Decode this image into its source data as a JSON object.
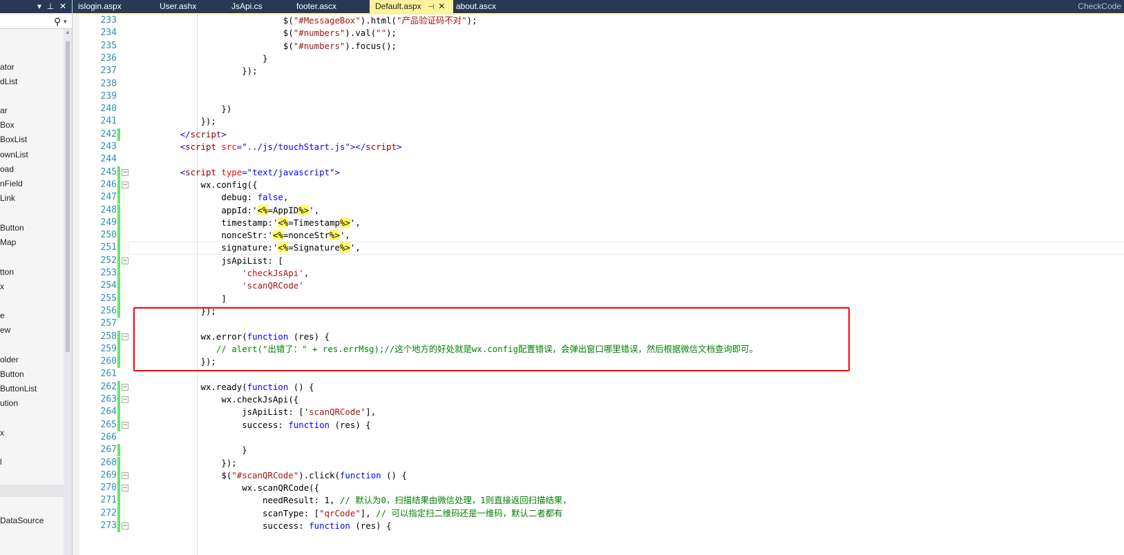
{
  "toolbox": {
    "header_buttons": [
      "▾",
      "⊥",
      "✕"
    ],
    "search_icon": "search-icon",
    "items": [
      "ator",
      "dList",
      "ar",
      "Box",
      "BoxList",
      "ownList",
      "oad",
      "nField",
      "Link",
      "Button",
      "Map",
      "tton",
      "x",
      "e",
      "ew",
      "older",
      "Button",
      "ButtonList",
      "ution",
      "x",
      "l",
      "DataSource"
    ]
  },
  "tabs": [
    {
      "label": "islogin.aspx"
    },
    {
      "label": "User.ashx"
    },
    {
      "label": "JsApi.cs"
    },
    {
      "label": "footer.ascx"
    },
    {
      "label": "Default.aspx",
      "active": true
    },
    {
      "label": "about.ascx"
    }
  ],
  "tab_right_label": "CheckCode",
  "editor": {
    "lines": [
      {
        "n": "233",
        "segs": [
          [
            "",
            "                            $("
          ],
          [
            "str",
            "\"#MessageBox\""
          ],
          [
            "",
            ").html("
          ],
          [
            "str",
            "\"产品验证码不对\""
          ],
          [
            "",
            ");"
          ]
        ]
      },
      {
        "n": "234",
        "segs": [
          [
            "",
            "                            $("
          ],
          [
            "str",
            "\"#numbers\""
          ],
          [
            "",
            ").val("
          ],
          [
            "str",
            "\"\""
          ],
          [
            "",
            ");"
          ]
        ]
      },
      {
        "n": "235",
        "segs": [
          [
            "",
            "                            $("
          ],
          [
            "str",
            "\"#numbers\""
          ],
          [
            "",
            ").focus();"
          ]
        ]
      },
      {
        "n": "236",
        "segs": [
          [
            "",
            "                        }"
          ]
        ]
      },
      {
        "n": "237",
        "segs": [
          [
            "",
            "                    });"
          ]
        ]
      },
      {
        "n": "238",
        "segs": []
      },
      {
        "n": "239",
        "segs": []
      },
      {
        "n": "240",
        "segs": [
          [
            "",
            "                })"
          ]
        ]
      },
      {
        "n": "241",
        "segs": [
          [
            "",
            "            });"
          ]
        ]
      },
      {
        "n": "242",
        "chg": true,
        "segs": [
          [
            "",
            "        "
          ],
          [
            "kw",
            "</"
          ],
          [
            "tag",
            "script"
          ],
          [
            "kw",
            ">"
          ]
        ]
      },
      {
        "n": "243",
        "segs": [
          [
            "",
            "        "
          ],
          [
            "kw",
            "<"
          ],
          [
            "tag",
            "script"
          ],
          [
            "",
            " "
          ],
          [
            "attr",
            "src"
          ],
          [
            "kw",
            "="
          ],
          [
            "kw",
            "\"../js/touchStart.js\""
          ],
          [
            "kw",
            "></"
          ],
          [
            "tag",
            "script"
          ],
          [
            "kw",
            ">"
          ]
        ]
      },
      {
        "n": "244",
        "segs": []
      },
      {
        "n": "245",
        "chg": true,
        "fold": "⊟",
        "segs": [
          [
            "",
            "        "
          ],
          [
            "kw",
            "<"
          ],
          [
            "tag",
            "script"
          ],
          [
            "",
            " "
          ],
          [
            "attr",
            "type"
          ],
          [
            "kw",
            "="
          ],
          [
            "kw",
            "\"text/javascript\""
          ],
          [
            "kw",
            ">"
          ]
        ]
      },
      {
        "n": "246",
        "chg": true,
        "fold": "⊟",
        "segs": [
          [
            "",
            "            wx.config({"
          ]
        ]
      },
      {
        "n": "247",
        "chg": true,
        "segs": [
          [
            "",
            "                debug: "
          ],
          [
            "kw",
            "false"
          ],
          [
            "",
            ","
          ]
        ]
      },
      {
        "n": "248",
        "chg": true,
        "segs": [
          [
            "",
            "                appId:'"
          ],
          [
            "del",
            "<%"
          ],
          [
            "",
            "=AppID"
          ],
          [
            "del",
            "%>"
          ],
          [
            "",
            "',"
          ]
        ]
      },
      {
        "n": "249",
        "chg": true,
        "segs": [
          [
            "",
            "                timestamp:'"
          ],
          [
            "del",
            "<%"
          ],
          [
            "",
            "=Timestamp"
          ],
          [
            "del",
            "%>"
          ],
          [
            "",
            "',"
          ]
        ]
      },
      {
        "n": "250",
        "chg": true,
        "segs": [
          [
            "",
            "                nonceStr:'"
          ],
          [
            "del",
            "<%"
          ],
          [
            "",
            "=nonceStr"
          ],
          [
            "del",
            "%>"
          ],
          [
            "",
            "',"
          ]
        ]
      },
      {
        "n": "251",
        "chg": true,
        "segs": [
          [
            "",
            "                signature:'"
          ],
          [
            "del",
            "<%"
          ],
          [
            "",
            "=Signature"
          ],
          [
            "del",
            "%>"
          ],
          [
            "",
            "',"
          ]
        ]
      },
      {
        "n": "252",
        "chg": true,
        "fold": "⊟",
        "segs": [
          [
            "",
            "                jsApiList: ["
          ]
        ]
      },
      {
        "n": "253",
        "chg": true,
        "segs": [
          [
            "",
            "                    "
          ],
          [
            "str",
            "'checkJsApi'"
          ],
          [
            "",
            ","
          ]
        ]
      },
      {
        "n": "254",
        "chg": true,
        "segs": [
          [
            "",
            "                    "
          ],
          [
            "str",
            "'scanQRCode'"
          ]
        ]
      },
      {
        "n": "255",
        "chg": true,
        "segs": [
          [
            "",
            "                ]"
          ]
        ]
      },
      {
        "n": "256",
        "chg": true,
        "segs": [
          [
            "",
            "            });"
          ]
        ]
      },
      {
        "n": "257",
        "segs": []
      },
      {
        "n": "258",
        "chg": true,
        "fold": "⊟",
        "segs": [
          [
            "",
            "            wx.error("
          ],
          [
            "kw",
            "function"
          ],
          [
            "",
            " (res) {"
          ]
        ]
      },
      {
        "n": "259",
        "chg": true,
        "segs": [
          [
            "",
            "               "
          ],
          [
            "cm",
            "// alert(\"出错了：\" + res.errMsg);//这个地方的好处就是wx.config配置错误，会弹出窗口哪里错误，然后根据微信文档查询即可。"
          ]
        ]
      },
      {
        "n": "260",
        "chg": true,
        "segs": [
          [
            "",
            "            });"
          ]
        ]
      },
      {
        "n": "261",
        "segs": []
      },
      {
        "n": "262",
        "chg": true,
        "fold": "⊟",
        "segs": [
          [
            "",
            "            wx.ready("
          ],
          [
            "kw",
            "function"
          ],
          [
            "",
            " () {"
          ]
        ]
      },
      {
        "n": "263",
        "chg": true,
        "fold": "⊟",
        "segs": [
          [
            "",
            "                wx.checkJsApi({"
          ]
        ]
      },
      {
        "n": "264",
        "chg": true,
        "segs": [
          [
            "",
            "                    jsApiList: ['"
          ],
          [
            "str",
            "scanQRCode"
          ],
          [
            "",
            "'],"
          ]
        ]
      },
      {
        "n": "265",
        "chg": true,
        "fold": "⊟",
        "segs": [
          [
            "",
            "                    success: "
          ],
          [
            "kw",
            "function"
          ],
          [
            "",
            " (res) {"
          ]
        ]
      },
      {
        "n": "266",
        "segs": []
      },
      {
        "n": "267",
        "chg": true,
        "segs": [
          [
            "",
            "                    }"
          ]
        ]
      },
      {
        "n": "268",
        "chg": true,
        "segs": [
          [
            "",
            "                });"
          ]
        ]
      },
      {
        "n": "269",
        "chg": true,
        "fold": "⊟",
        "segs": [
          [
            "",
            "                $("
          ],
          [
            "str",
            "\"#scanQRCode\""
          ],
          [
            "",
            ").click("
          ],
          [
            "kw",
            "function"
          ],
          [
            "",
            " () {"
          ]
        ]
      },
      {
        "n": "270",
        "chg": true,
        "fold": "⊟",
        "segs": [
          [
            "",
            "                    wx.scanQRCode({"
          ]
        ]
      },
      {
        "n": "271",
        "chg": true,
        "segs": [
          [
            "",
            "                        needResult: 1, "
          ],
          [
            "cm",
            "// 默认为0，扫描结果由微信处理，1则直接返回扫描结果，"
          ]
        ]
      },
      {
        "n": "272",
        "chg": true,
        "segs": [
          [
            "",
            "                        scanType: ["
          ],
          [
            "str",
            "\"qrCode\""
          ],
          [
            "",
            "], "
          ],
          [
            "cm",
            "// 可以指定扫二维码还是一维码，默认二者都有"
          ]
        ]
      },
      {
        "n": "273",
        "chg": true,
        "fold": "⊟",
        "segs": [
          [
            "",
            "                        success: "
          ],
          [
            "kw",
            "function"
          ],
          [
            "",
            " (res) {"
          ]
        ]
      }
    ]
  },
  "colors": {
    "title_bar": "#293955",
    "active_tab": "#fff29d",
    "line_number": "#2b91af",
    "change_bar": "#6ce26c",
    "highlight_box": "#ff0000"
  }
}
